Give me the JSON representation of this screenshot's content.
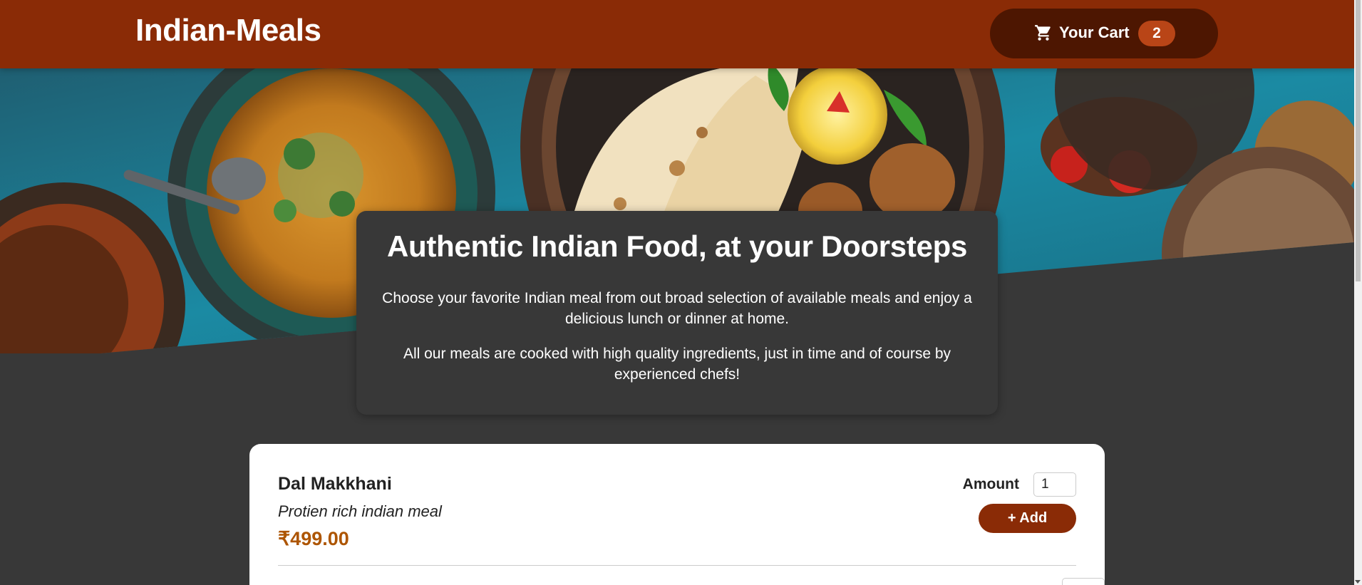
{
  "header": {
    "brand": "Indian-Meals",
    "cart": {
      "label": "Your Cart",
      "count": "2",
      "icon": "cart-icon"
    }
  },
  "colors": {
    "header_bg": "#8a2b06",
    "cart_bg": "#4d1601",
    "badge_bg": "#b94517",
    "page_bg": "#383838",
    "price": "#ad5502"
  },
  "summary": {
    "title": "Authentic Indian Food, at your Doorsteps",
    "paragraph1": "Choose your favorite Indian meal from out broad selection of available meals and enjoy a delicious lunch or dinner at home.",
    "paragraph2": "All our meals are cooked with high quality ingredients, just in time and of course by experienced chefs!"
  },
  "meals": [
    {
      "name": "Dal Makkhani",
      "description": "Protien rich indian meal",
      "price": "₹499.00",
      "amount_label": "Amount",
      "amount_value": "1",
      "add_label": "+ Add"
    }
  ]
}
